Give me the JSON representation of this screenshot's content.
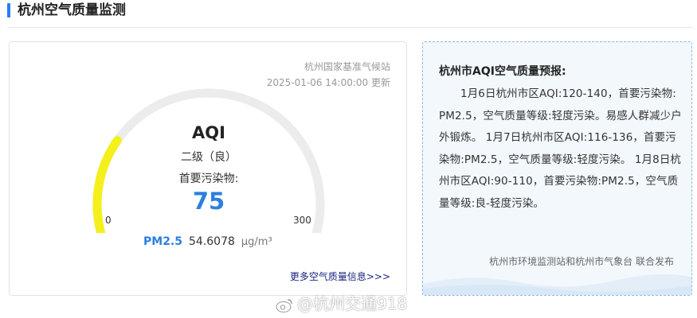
{
  "header": {
    "title": "杭州空气质量监测"
  },
  "station": {
    "name": "杭州国家基准气候站",
    "updated": "2025-01-06 14:00:00 更新"
  },
  "aqi": {
    "title": "AQI",
    "level": "二级（良）",
    "pollutant_label": "首要污染物:",
    "value": "75",
    "scale_min": "0",
    "scale_max": "300",
    "fraction": 0.25,
    "level_color": "#f5ef1c",
    "track_color": "#ececec"
  },
  "pm25": {
    "name": "PM2.5",
    "value": "54.6078",
    "unit": "µg/m³"
  },
  "more_link": "更多空气质量信息>>>",
  "forecast": {
    "title": "杭州市AQI空气质量预报:",
    "body": "1月6日杭州市区AQI:120-140，首要污染物:PM2.5，空气质量等级:轻度污染。易感人群减少户外锻炼。 1月7日杭州市区AQI:116-136，首要污染物:PM2.5，空气质量等级:轻度污染。 1月8日杭州市区AQI:90-110，首要污染物:PM2.5，空气质量等级:良-轻度污染。",
    "footer": "杭州市环境监测站和杭州市气象台 联合发布"
  },
  "watermark": {
    "text": "@杭州交通918",
    "icon": "weibo-icon"
  },
  "colors": {
    "accent": "#2b7cf6",
    "value_blue": "#2b7fe0",
    "link": "#1a237e",
    "panel_bg": "#f3f8fd",
    "panel_border": "#8ab8e6"
  }
}
